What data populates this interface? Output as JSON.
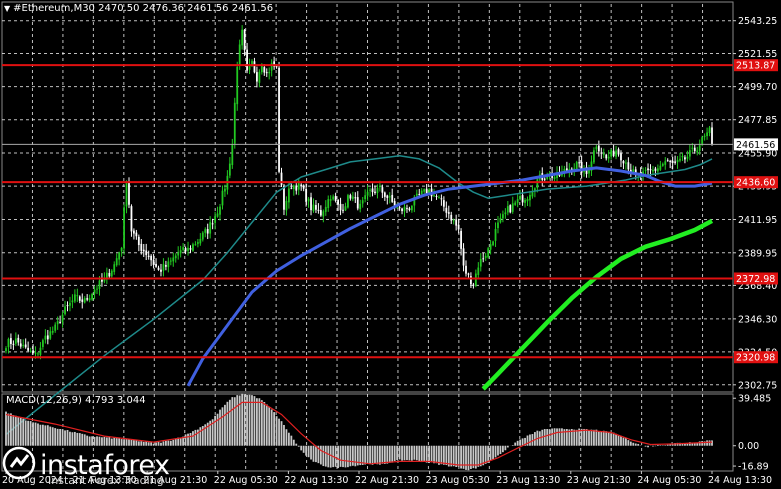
{
  "header": {
    "symbol": "#Ethereum,M30",
    "ohlc": "2470.50 2476.36 2461.56 2461.56"
  },
  "macd_label": "MACD(12,26,9) 4.793 3.044",
  "logo": {
    "word": "instaforex",
    "sub": "Instant Forex Trading"
  },
  "colors": {
    "background": "#000000",
    "grid": "#ffffff",
    "bull_candle": "#22c922",
    "bear_candle": "#ffffff",
    "level_line": "#e01010",
    "ma_fast": "#1e8a8a",
    "ma_mid": "#4060e0",
    "ma_slow": "#22ee22",
    "macd_hist": "#c8c8c8",
    "macd_signal": "#e02020"
  },
  "chart_data": [
    {
      "type": "candlestick",
      "title": "#Ethereum,M30",
      "price_ticks": [
        "2543.25",
        "2521.55",
        "2499.70",
        "2477.85",
        "2455.90",
        "2433.95",
        "2411.95",
        "2389.95",
        "2368.40",
        "2346.30",
        "2324.50",
        "2302.75"
      ],
      "time_ticks": [
        "20 Aug 2024",
        "21 Aug 13:30",
        "21 Aug 21:30",
        "22 Aug 05:30",
        "22 Aug 13:30",
        "22 Aug 21:30",
        "23 Aug 05:30",
        "23 Aug 13:30",
        "23 Aug 21:30",
        "24 Aug 05:30",
        "24 Aug 13:30"
      ],
      "ylim": [
        2298.0,
        2549.0
      ],
      "current_price": "2461.56",
      "levels": [
        "2513.87",
        "2436.60",
        "2372.98",
        "2320.98"
      ],
      "close_path": [
        [
          0,
          2330
        ],
        [
          4,
          2332
        ],
        [
          8,
          2326
        ],
        [
          12,
          2322
        ],
        [
          16,
          2334
        ],
        [
          20,
          2340
        ],
        [
          24,
          2352
        ],
        [
          28,
          2360
        ],
        [
          32,
          2358
        ],
        [
          36,
          2366
        ],
        [
          40,
          2372
        ],
        [
          44,
          2382
        ],
        [
          47,
          2395
        ],
        [
          49,
          2440
        ],
        [
          51,
          2405
        ],
        [
          54,
          2395
        ],
        [
          58,
          2388
        ],
        [
          62,
          2378
        ],
        [
          66,
          2382
        ],
        [
          70,
          2390
        ],
        [
          74,
          2392
        ],
        [
          78,
          2398
        ],
        [
          82,
          2405
        ],
        [
          86,
          2418
        ],
        [
          88,
          2428
        ],
        [
          90,
          2440
        ],
        [
          92,
          2462
        ],
        [
          94,
          2515
        ],
        [
          96,
          2535
        ],
        [
          98,
          2508
        ],
        [
          100,
          2515
        ],
        [
          102,
          2506
        ],
        [
          104,
          2516
        ],
        [
          106,
          2508
        ],
        [
          108,
          2514
        ],
        [
          110,
          2512
        ],
        [
          111,
          2445
        ],
        [
          113,
          2420
        ],
        [
          116,
          2435
        ],
        [
          120,
          2433
        ],
        [
          124,
          2420
        ],
        [
          128,
          2416
        ],
        [
          132,
          2428
        ],
        [
          136,
          2418
        ],
        [
          140,
          2428
        ],
        [
          144,
          2420
        ],
        [
          148,
          2430
        ],
        [
          152,
          2432
        ],
        [
          156,
          2425
        ],
        [
          160,
          2418
        ],
        [
          164,
          2420
        ],
        [
          168,
          2428
        ],
        [
          172,
          2431
        ],
        [
          176,
          2425
        ],
        [
          180,
          2416
        ],
        [
          184,
          2405
        ],
        [
          186,
          2380
        ],
        [
          188,
          2374
        ],
        [
          190,
          2370
        ],
        [
          192,
          2382
        ],
        [
          196,
          2392
        ],
        [
          200,
          2408
        ],
        [
          204,
          2418
        ],
        [
          208,
          2424
        ],
        [
          212,
          2428
        ],
        [
          216,
          2438
        ],
        [
          220,
          2442
        ],
        [
          224,
          2440
        ],
        [
          228,
          2445
        ],
        [
          232,
          2448
        ],
        [
          236,
          2442
        ],
        [
          240,
          2462
        ],
        [
          244,
          2452
        ],
        [
          248,
          2458
        ],
        [
          252,
          2450
        ],
        [
          256,
          2440
        ],
        [
          260,
          2442
        ],
        [
          264,
          2445
        ],
        [
          268,
          2450
        ],
        [
          272,
          2448
        ],
        [
          276,
          2452
        ],
        [
          280,
          2458
        ],
        [
          284,
          2466
        ],
        [
          286,
          2470
        ],
        [
          287,
          2461.56
        ]
      ],
      "ma_fast": [
        [
          0,
          2270
        ],
        [
          20,
          2296
        ],
        [
          40,
          2322
        ],
        [
          60,
          2346
        ],
        [
          80,
          2372
        ],
        [
          90,
          2390
        ],
        [
          100,
          2410
        ],
        [
          110,
          2430
        ],
        [
          120,
          2440
        ],
        [
          130,
          2445
        ],
        [
          140,
          2450
        ],
        [
          150,
          2452
        ],
        [
          160,
          2454
        ],
        [
          168,
          2452
        ],
        [
          176,
          2446
        ],
        [
          184,
          2436
        ],
        [
          190,
          2430
        ],
        [
          196,
          2426
        ],
        [
          204,
          2428
        ],
        [
          212,
          2430
        ],
        [
          220,
          2432
        ],
        [
          228,
          2433
        ],
        [
          236,
          2434
        ],
        [
          244,
          2436
        ],
        [
          252,
          2438
        ],
        [
          260,
          2441
        ],
        [
          268,
          2443
        ],
        [
          276,
          2445
        ],
        [
          282,
          2448
        ],
        [
          287,
          2452
        ]
      ],
      "ma_mid": [
        [
          74,
          2302
        ],
        [
          80,
          2320
        ],
        [
          90,
          2342
        ],
        [
          100,
          2364
        ],
        [
          110,
          2378
        ],
        [
          120,
          2388
        ],
        [
          130,
          2397
        ],
        [
          140,
          2406
        ],
        [
          150,
          2414
        ],
        [
          160,
          2422
        ],
        [
          170,
          2428
        ],
        [
          180,
          2432
        ],
        [
          190,
          2434
        ],
        [
          200,
          2436
        ],
        [
          210,
          2438
        ],
        [
          220,
          2441
        ],
        [
          230,
          2444
        ],
        [
          240,
          2446
        ],
        [
          250,
          2444
        ],
        [
          260,
          2441
        ],
        [
          266,
          2437
        ],
        [
          272,
          2434
        ],
        [
          280,
          2434
        ],
        [
          287,
          2436
        ]
      ],
      "ma_slow": [
        [
          194,
          2300
        ],
        [
          200,
          2310
        ],
        [
          210,
          2327
        ],
        [
          220,
          2344
        ],
        [
          230,
          2360
        ],
        [
          240,
          2374
        ],
        [
          250,
          2386
        ],
        [
          260,
          2394
        ],
        [
          270,
          2399
        ],
        [
          280,
          2405
        ],
        [
          287,
          2411
        ]
      ]
    },
    {
      "type": "bar",
      "title": "MACD(12,26,9) 4.793 3.044",
      "y_ticks": [
        "39.485",
        "0.00",
        "-16.89"
      ],
      "ylim": [
        -21.0,
        43.0
      ],
      "histogram_segments": [
        [
          0,
          28
        ],
        [
          10,
          20
        ],
        [
          22,
          14
        ],
        [
          34,
          8
        ],
        [
          46,
          6
        ],
        [
          54,
          4
        ],
        [
          60,
          2
        ],
        [
          66,
          4
        ],
        [
          72,
          8
        ],
        [
          78,
          14
        ],
        [
          84,
          22
        ],
        [
          88,
          32
        ],
        [
          92,
          40
        ],
        [
          96,
          43
        ],
        [
          100,
          42
        ],
        [
          104,
          38
        ],
        [
          108,
          30
        ],
        [
          112,
          20
        ],
        [
          116,
          8
        ],
        [
          120,
          -4
        ],
        [
          124,
          -12
        ],
        [
          128,
          -16
        ],
        [
          132,
          -18
        ],
        [
          136,
          -18
        ],
        [
          140,
          -17
        ],
        [
          144,
          -16
        ],
        [
          148,
          -15
        ],
        [
          152,
          -16
        ],
        [
          156,
          -14
        ],
        [
          160,
          -12
        ],
        [
          166,
          -12
        ],
        [
          172,
          -14
        ],
        [
          178,
          -16
        ],
        [
          184,
          -18
        ],
        [
          188,
          -20
        ],
        [
          192,
          -18
        ],
        [
          196,
          -14
        ],
        [
          200,
          -8
        ],
        [
          204,
          -2
        ],
        [
          208,
          4
        ],
        [
          212,
          8
        ],
        [
          216,
          12
        ],
        [
          220,
          14
        ],
        [
          230,
          14
        ],
        [
          240,
          13
        ],
        [
          248,
          10
        ],
        [
          252,
          6
        ],
        [
          256,
          2
        ],
        [
          260,
          -1
        ],
        [
          264,
          0
        ],
        [
          272,
          2
        ],
        [
          280,
          3
        ],
        [
          287,
          4.8
        ]
      ],
      "signal_segments": [
        [
          0,
          26
        ],
        [
          20,
          18
        ],
        [
          40,
          8
        ],
        [
          60,
          3
        ],
        [
          76,
          8
        ],
        [
          88,
          24
        ],
        [
          96,
          36
        ],
        [
          104,
          36
        ],
        [
          112,
          26
        ],
        [
          120,
          10
        ],
        [
          128,
          -4
        ],
        [
          136,
          -12
        ],
        [
          148,
          -15
        ],
        [
          160,
          -13
        ],
        [
          172,
          -13
        ],
        [
          184,
          -16
        ],
        [
          192,
          -16
        ],
        [
          200,
          -10
        ],
        [
          208,
          -2
        ],
        [
          216,
          6
        ],
        [
          224,
          11
        ],
        [
          236,
          13
        ],
        [
          246,
          11
        ],
        [
          254,
          5
        ],
        [
          262,
          1
        ],
        [
          272,
          1.5
        ],
        [
          287,
          3.0
        ]
      ]
    }
  ]
}
